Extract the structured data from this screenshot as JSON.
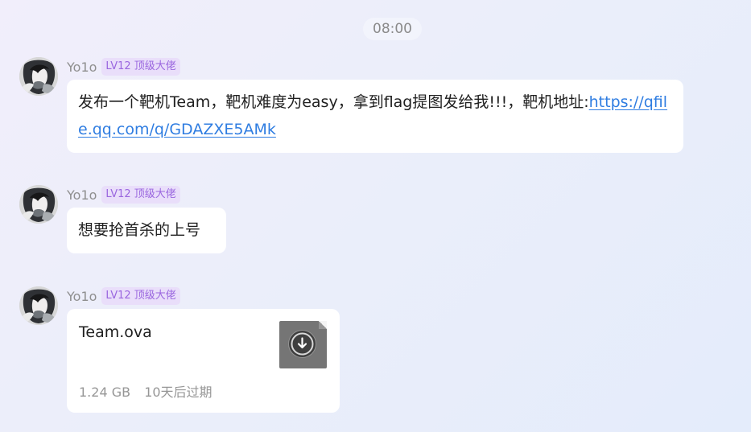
{
  "time_divider": "08:00",
  "messages": [
    {
      "sender": "Yo1o",
      "badge": "LV12 顶级大佬",
      "text_prefix": "发布一个靶机Team，靶机难度为easy，拿到flag提图发给我!!!，靶机地址:",
      "link_text": "https://qfile.qq.com/q/GDAZXE5AMk"
    },
    {
      "sender": "Yo1o",
      "badge": "LV12 顶级大佬",
      "text": "想要抢首杀的上号"
    },
    {
      "sender": "Yo1o",
      "badge": "LV12 顶级大佬",
      "file": {
        "name": "Team.ova",
        "size": "1.24 GB",
        "expiry": "10天后过期",
        "icon": "download-icon"
      }
    }
  ]
}
